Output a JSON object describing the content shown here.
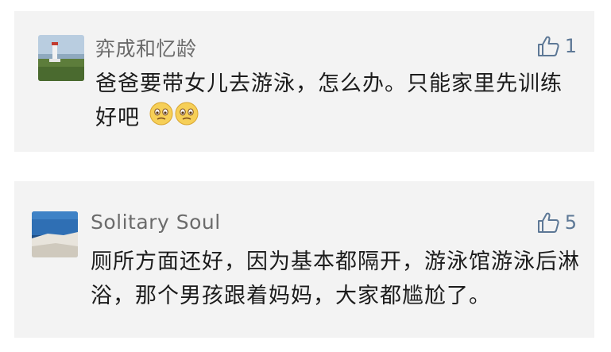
{
  "comments": [
    {
      "username": "弈成和忆龄",
      "likes": "1",
      "text": "爸爸要带女儿去游泳，怎么办。只能家里先训练好吧",
      "emojis": [
        "sob-emoji",
        "sob-emoji"
      ],
      "avatar_icon": "lighthouse-photo-avatar"
    },
    {
      "username": "Solitary Soul",
      "likes": "5",
      "text": "厕所方面还好，因为基本都隔开，游泳馆游泳后淋浴，那个男孩跟着妈妈，大家都尴尬了。",
      "avatar_icon": "cliff-sea-photo-avatar"
    }
  ],
  "colors": {
    "card_bg": "#f3f3f3",
    "name": "#6b6b6b",
    "like": "#5d7896",
    "text": "#1c1c1c"
  }
}
